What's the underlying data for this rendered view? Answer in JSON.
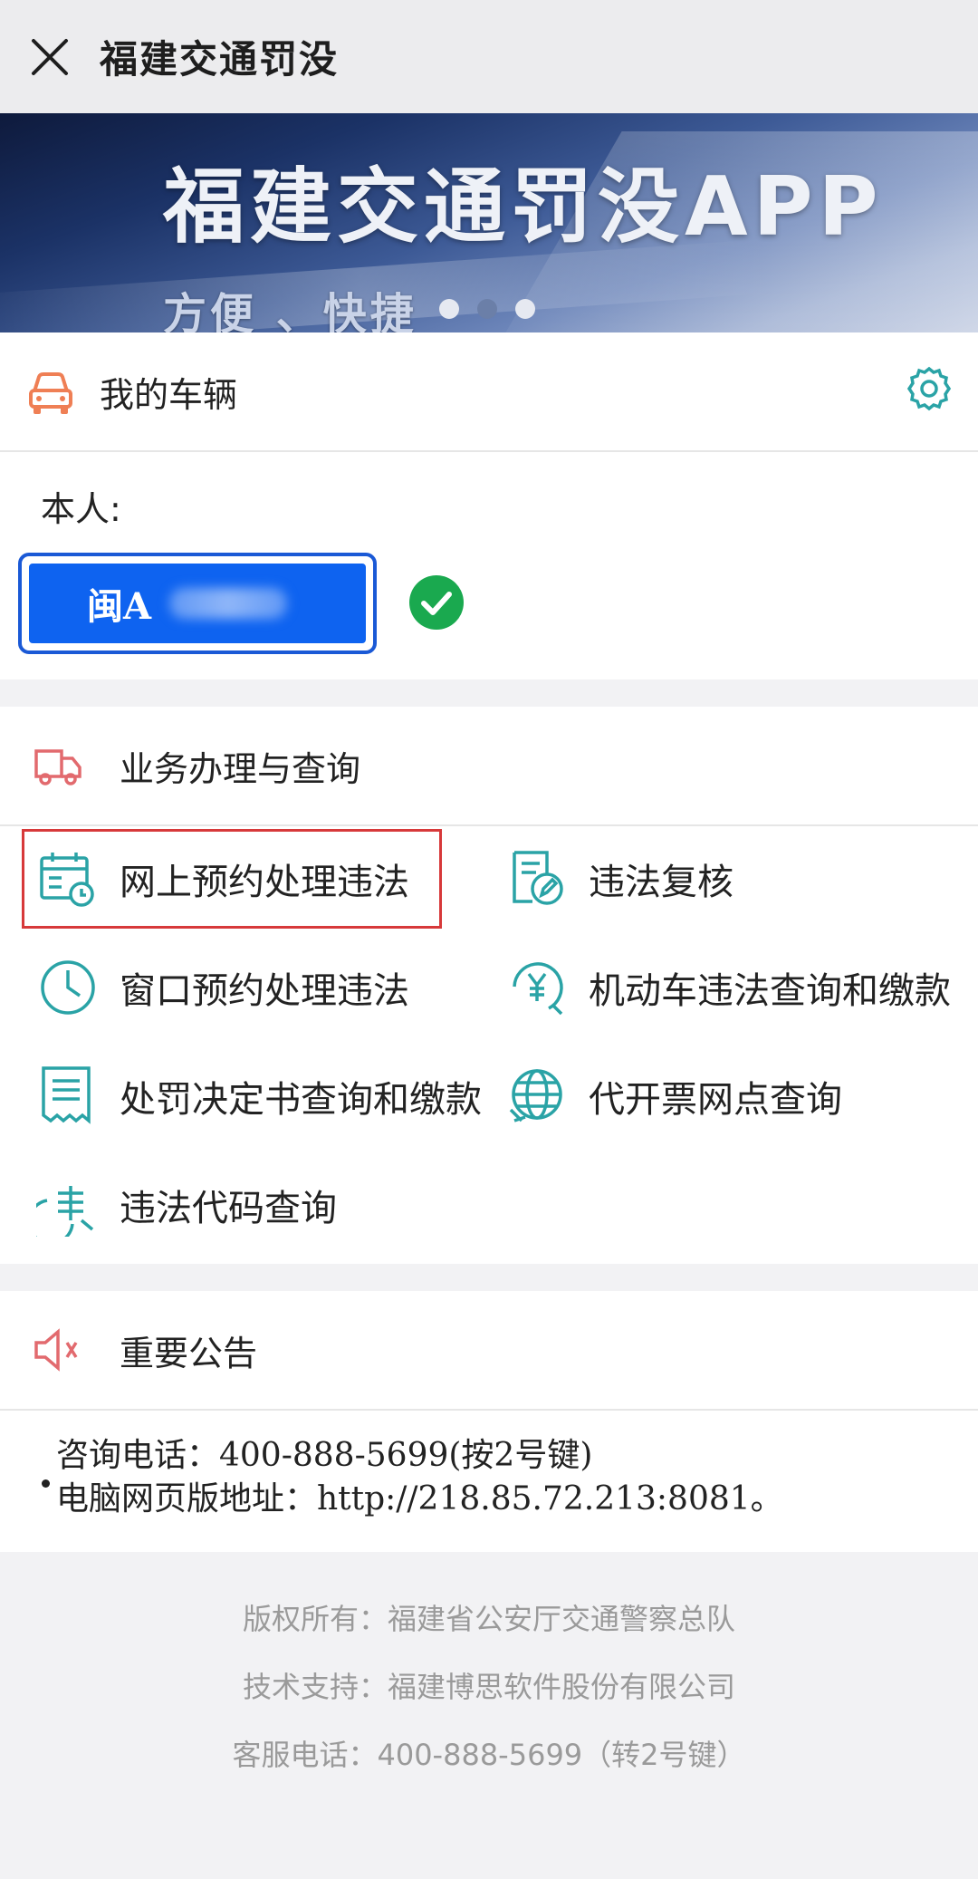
{
  "titlebar": {
    "title": "福建交通罚没"
  },
  "banner": {
    "title": "福建交通罚没APP",
    "subtitle": "方便 、快捷",
    "slide_count": 3,
    "active_slide": 1
  },
  "vehicle": {
    "section_label": "我的车辆",
    "owner_label": "本人:",
    "plate_prefix": "闽A",
    "verified": true
  },
  "services": {
    "section_label": "业务办理与查询",
    "items": [
      {
        "label": "网上预约处理违法",
        "icon": "calendar-clock-icon",
        "highlighted": true
      },
      {
        "label": "违法复核",
        "icon": "document-edit-icon"
      },
      {
        "label": "窗口预约处理违法",
        "icon": "clock-icon"
      },
      {
        "label": "机动车违法查询和缴款",
        "icon": "yen-search-icon"
      },
      {
        "label": "处罚决定书查询和缴款",
        "icon": "receipt-icon"
      },
      {
        "label": "代开票网点查询",
        "icon": "globe-icon"
      },
      {
        "label": "违法代码查询",
        "icon": "code-search-icon"
      }
    ]
  },
  "notice": {
    "section_label": "重要公告",
    "lines": [
      "咨询电话：400-888-5699(按2号键)",
      "电脑网页版地址：http://218.85.72.213:8081。"
    ]
  },
  "footer": {
    "lines": [
      "版权所有：福建省公安厅交通警察总队",
      "技术支持：福建博思软件股份有限公司",
      "客服电话：400-888-5699（转2号键）"
    ]
  },
  "colors": {
    "accent_teal": "#2aa3a6",
    "accent_orange": "#ef7f55",
    "plate_blue": "#0e63f0",
    "check_green": "#1aa94f",
    "highlight_red": "#d7393a"
  }
}
